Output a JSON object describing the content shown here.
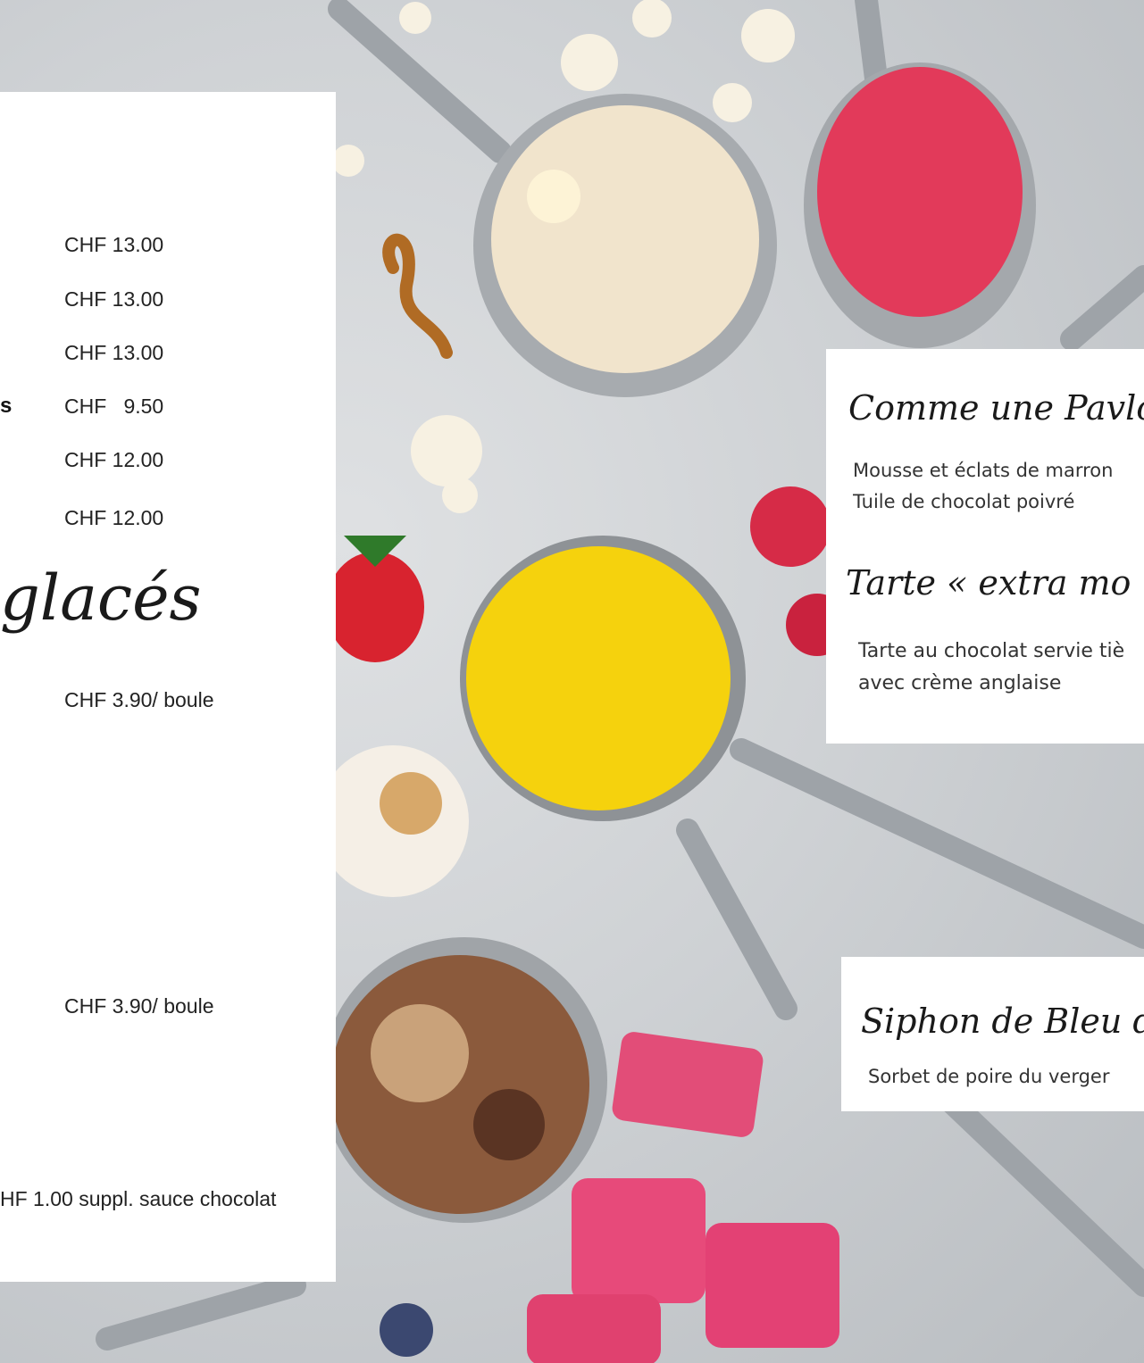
{
  "left_menu": {
    "prices": [
      "CHF 13.00",
      "CHF 13.00",
      "CHF 13.00",
      "CHF   9.50",
      "CHF 12.00",
      "CHF 12.00"
    ],
    "cut_letter": "s",
    "section_title": "glacés",
    "price_scoop_1": "CHF 3.90/ boule",
    "price_scoop_2": "CHF 3.90/ boule",
    "supplement": "HF 1.00 suppl. sauce chocolat"
  },
  "right_cards": {
    "pavlova_title": "Comme une Pavlov",
    "pavlova_desc_1": "Mousse et éclats de marron",
    "pavlova_desc_2": "Tuile de chocolat poivré",
    "tarte_title": "Tarte « extra mo",
    "tarte_desc_1": "Tarte au chocolat servie tiè",
    "tarte_desc_2": "avec crème anglaise",
    "siphon_title": "Siphon de Bleu d",
    "siphon_desc": "Sorbet de poire du verger"
  }
}
